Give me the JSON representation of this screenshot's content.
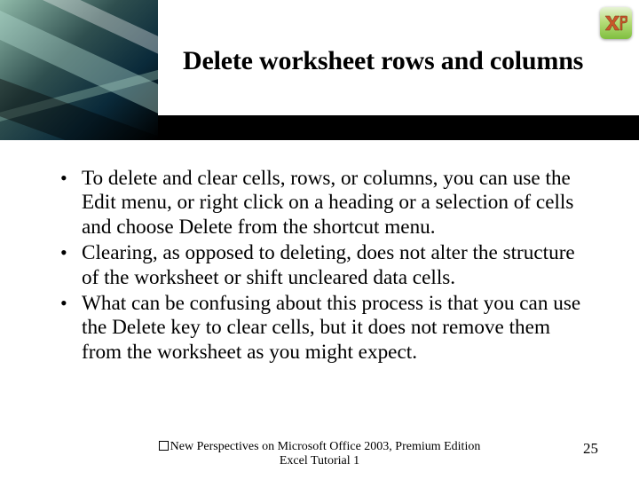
{
  "title": "Delete worksheet rows and columns",
  "bullets": [
    "To delete and clear cells, rows, or columns, you can use the Edit menu, or right click on a heading or a selection of cells and choose Delete from the shortcut menu.",
    "Clearing, as opposed to deleting, does not alter the structure of the worksheet or shift uncleared data cells.",
    "What can be confusing about this process is that you can use the Delete key to clear cells, but it does not remove them from the worksheet as you might expect."
  ],
  "footer": {
    "line1": "New Perspectives on Microsoft Office 2003, Premium Edition",
    "line2": "Excel Tutorial 1"
  },
  "page_number": "25",
  "badge": {
    "label": "XP"
  }
}
